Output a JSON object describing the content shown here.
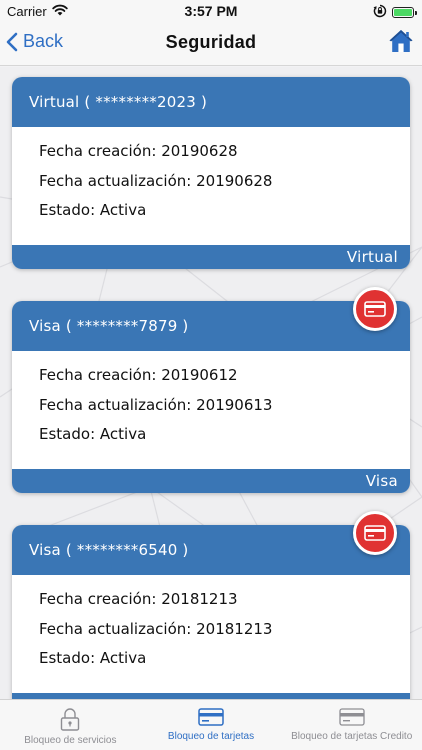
{
  "status_bar": {
    "carrier": "Carrier",
    "time": "3:57 PM",
    "battery_level": 1.0
  },
  "nav": {
    "back_label": "Back",
    "title": "Seguridad",
    "home_icon": "home-icon"
  },
  "cards": [
    {
      "header": "Virtual ( ********2023 )",
      "rows": [
        {
          "label": "Fecha creación:",
          "value": "20190628"
        },
        {
          "label": "Fecha actualización:",
          "value": "20190628"
        },
        {
          "label": "Estado:",
          "value": "Activa"
        }
      ],
      "footer": "Virtual",
      "has_block_button": false
    },
    {
      "header": "Visa ( ********7879 )",
      "rows": [
        {
          "label": "Fecha creación:",
          "value": "20190612"
        },
        {
          "label": "Fecha actualización:",
          "value": "20190613"
        },
        {
          "label": "Estado:",
          "value": "Activa"
        }
      ],
      "footer": "Visa",
      "has_block_button": true
    },
    {
      "header": "Visa ( ********6540 )",
      "rows": [
        {
          "label": "Fecha creación:",
          "value": "20181213"
        },
        {
          "label": "Fecha actualización:",
          "value": "20181213"
        },
        {
          "label": "Estado:",
          "value": "Activa"
        }
      ],
      "footer": "",
      "has_block_button": true
    }
  ],
  "tabs": [
    {
      "label": "Bloqueo de servicios",
      "icon": "lock-icon",
      "active": false
    },
    {
      "label": "Bloqueo de tarjetas",
      "icon": "credit-card-icon",
      "active": true
    },
    {
      "label": "Bloqueo de tarjetas Credito",
      "icon": "credit-card-icon",
      "active": false
    }
  ],
  "colors": {
    "primary": "#3a76b5",
    "accent_blue": "#2f6fc4",
    "block_red": "#e03232",
    "battery_green": "#4cd964"
  }
}
